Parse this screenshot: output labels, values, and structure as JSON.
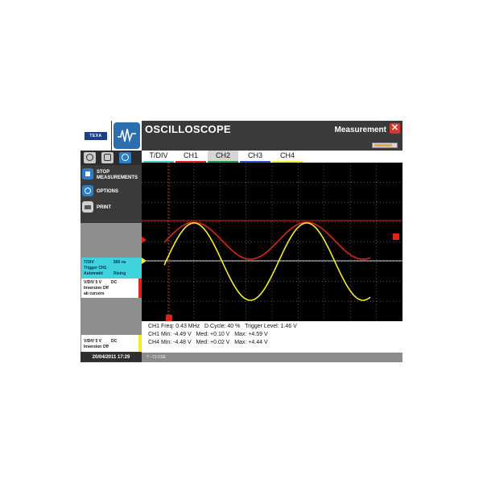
{
  "header": {
    "brand": "TEXA",
    "title": "OSCILLOSCOPE",
    "mode": "Measurement",
    "progress": 0.85
  },
  "icons": {
    "close": "close-icon",
    "app": "waveform-icon",
    "zoom": "zoom-icon",
    "settings": "gear-icon",
    "cursor": "cursor-icon",
    "stop": "stop-icon",
    "options": "gear-icon",
    "print": "printer-icon"
  },
  "tabs": [
    {
      "label": "T/DIV",
      "color": "#4fc3d6",
      "active": false
    },
    {
      "label": "CH1",
      "color": "#e32118",
      "active": false
    },
    {
      "label": "CH2",
      "color": "#1e9d3a",
      "active": true
    },
    {
      "label": "CH3",
      "color": "#2b56c6",
      "active": false
    },
    {
      "label": "CH4",
      "color": "#f6ec2b",
      "active": false
    }
  ],
  "menu": {
    "stop": "STOP MEASUREMENTS",
    "options": "OPTIONS",
    "print": "PRINT"
  },
  "info": {
    "tdiv_label": "T/DIV",
    "tdiv_value": "500 ns",
    "trigger_label": "Trigger CH1",
    "trigger_mode": "Automatic",
    "trigger_edge": "Rising",
    "ch1_vdiv": "V/DIV  5 V",
    "ch1_coupling": "DC",
    "ch1_inversion": "Inversion Off",
    "ch1_cursors": "ab cursors",
    "ch4_vdiv": "V/DIV  5 V",
    "ch4_coupling": "DC",
    "ch4_inversion": "Inversion Off"
  },
  "readout": {
    "line1": "CH1 Freq: 0.43 MHz   D.Cycle: 40 %   Trigger Level: 1.46 V",
    "line2": "CH1 Min: -4.49 V   Med: +0.10 V   Max: +4.59 V",
    "line3": "CH4 Min: -4.48 V   Med: +0.02 V   Max: +4.44 V"
  },
  "status": {
    "datetime": "20/04/2011  17:29",
    "hint": "? - CLOSE"
  },
  "colors": {
    "ch1": "#e32118",
    "ch4": "#f6ec2b",
    "accent": "#2d7ec4",
    "trigger_box": "#3fd3de"
  }
}
